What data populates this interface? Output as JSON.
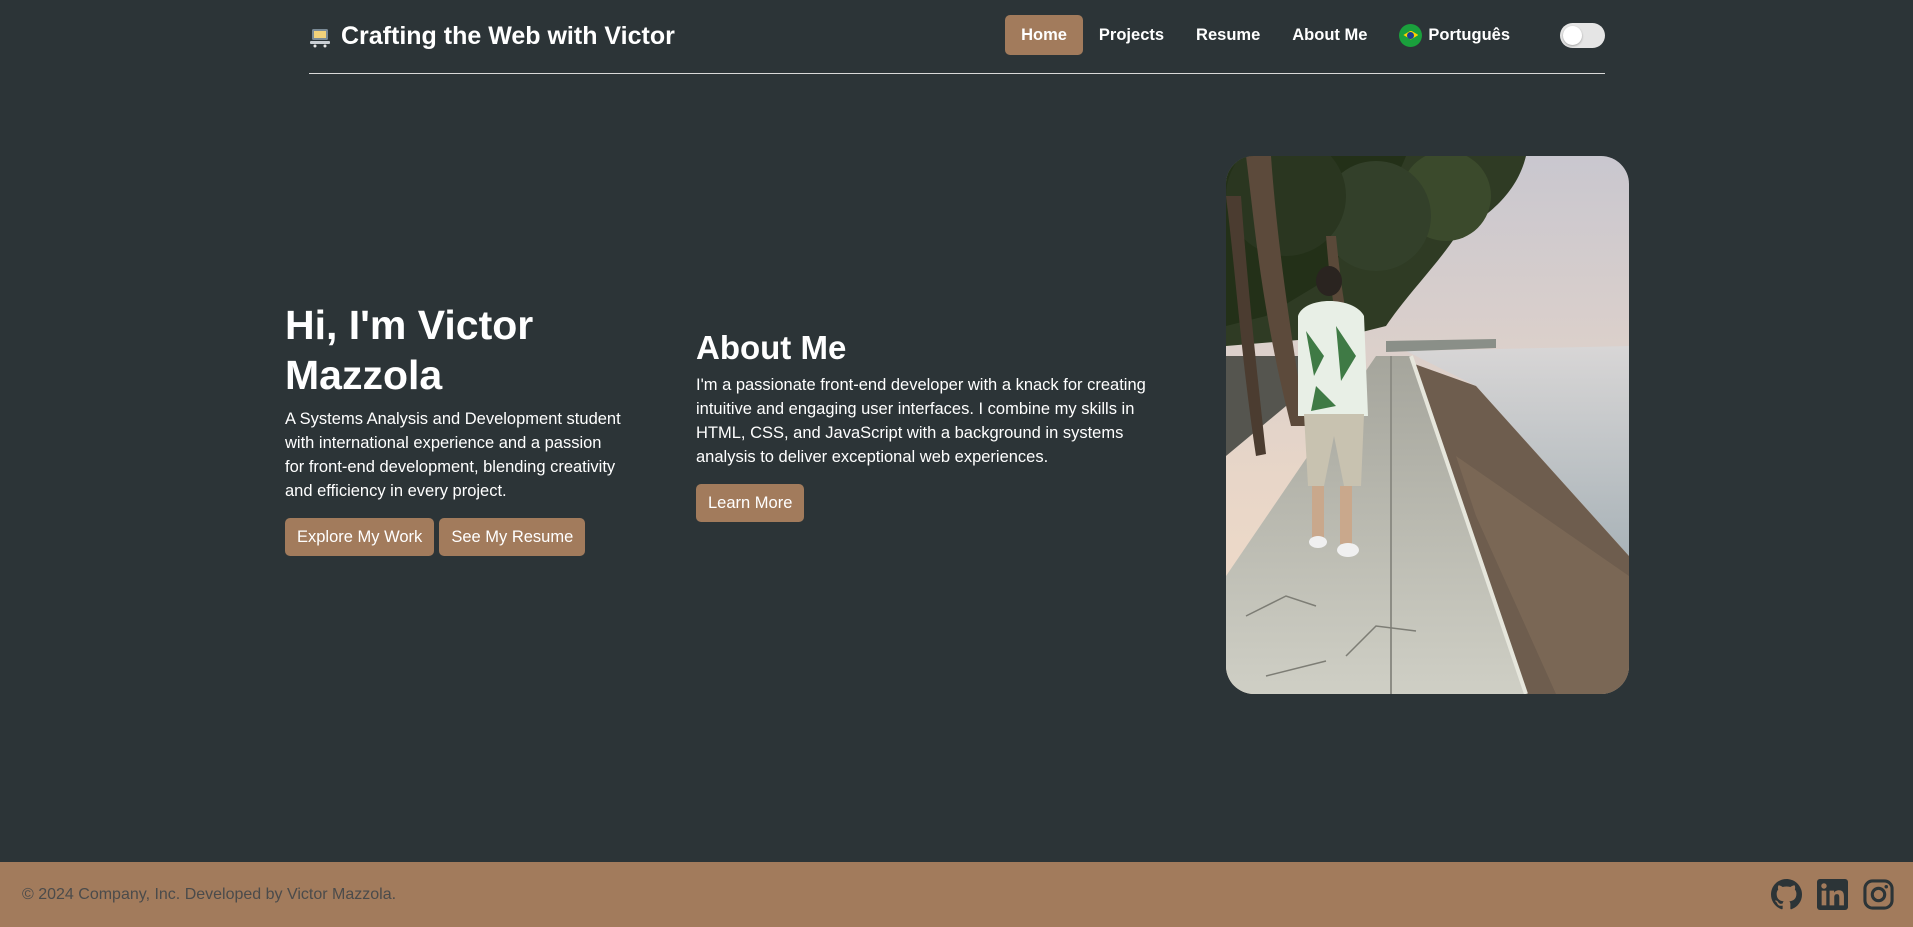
{
  "header": {
    "brand_icon": "laptop-emoji-icon",
    "title": "Crafting the Web with Victor",
    "nav": [
      {
        "label": "Home",
        "active": true
      },
      {
        "label": "Projects",
        "active": false
      },
      {
        "label": "Resume",
        "active": false
      },
      {
        "label": "About Me",
        "active": false
      }
    ],
    "language": {
      "label": "Português",
      "icon": "brazil-flag-icon"
    },
    "theme_toggle": {
      "icon": "toggle-switch",
      "state": "off"
    }
  },
  "hero": {
    "heading": "Hi, I'm Victor Mazzola",
    "text": "A Systems Analysis and Development student with international experience and a passion for front-end development, blending creativity and efficiency in every project.",
    "buttons": [
      "Explore My Work",
      "See My Resume"
    ]
  },
  "about": {
    "heading": "About Me",
    "text": "I'm a passionate front-end developer with a knack for creating intuitive and engaging user interfaces. I combine my skills in HTML, CSS, and JavaScript with a background in systems analysis to deliver exceptional web experiences.",
    "button": "Learn More"
  },
  "photo": {
    "icon": "profile-photo"
  },
  "footer": {
    "text": "© 2024 Company, Inc. Developed by Victor Mazzola.",
    "social": [
      "github-icon",
      "linkedin-icon",
      "instagram-icon"
    ]
  },
  "colors": {
    "background": "#2c3437",
    "accent": "#a27b5c",
    "text": "#ffffff",
    "footer_text": "#4b4b4b",
    "icon_dark": "#2c3437"
  }
}
